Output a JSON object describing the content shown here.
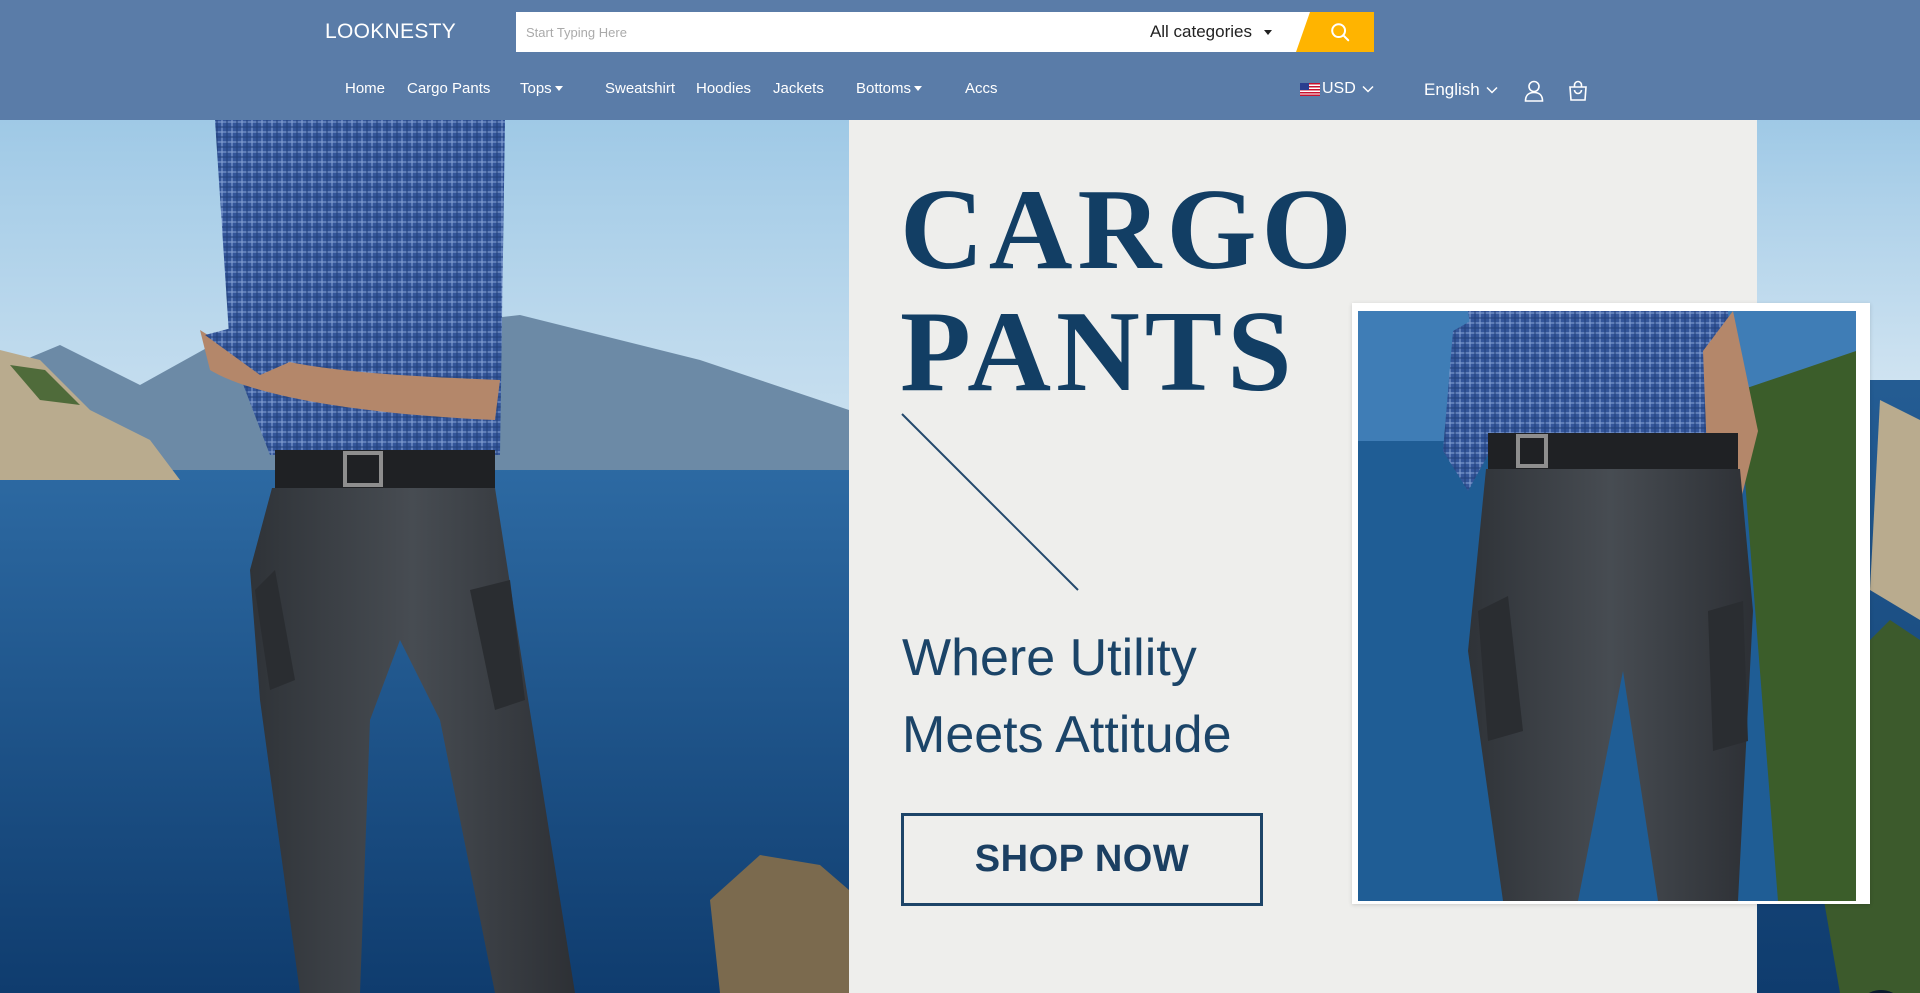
{
  "header": {
    "logo": "LOOKNESTY",
    "search": {
      "placeholder": "Start Typing Here",
      "value": ""
    },
    "category_select": "All categories"
  },
  "nav": {
    "items": [
      {
        "label": "Home"
      },
      {
        "label": "Cargo Pants"
      },
      {
        "label": "Tops",
        "has_dropdown": true
      },
      {
        "label": "Sweatshirt"
      },
      {
        "label": "Hoodies"
      },
      {
        "label": "Jackets"
      },
      {
        "label": "Bottoms",
        "has_dropdown": true
      },
      {
        "label": "Accs"
      }
    ],
    "currency": "USD",
    "language": "English"
  },
  "hero": {
    "headline_line1": "CARGO",
    "headline_line2": "PANTS",
    "tagline_line1": "Where Utility",
    "tagline_line2": "Meets Attitude",
    "cta": "SHOP NOW"
  },
  "icons": {
    "search": "search-icon",
    "flag": "us-flag-icon",
    "account": "user-icon",
    "cart": "shopping-bag-icon",
    "chat": "chat-icon"
  },
  "colors": {
    "header_bg": "#5a7ca8",
    "accent": "#ffb400",
    "headline": "#123e64",
    "panel_bg": "#eeeeec"
  }
}
